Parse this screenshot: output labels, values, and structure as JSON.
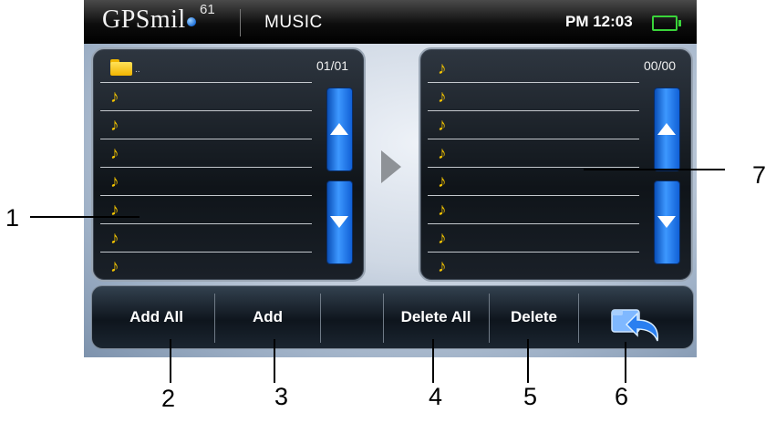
{
  "status_bar": {
    "brand": "GPSmil",
    "brand_suffix": "e",
    "brand_superscript": "61",
    "title": "MUSIC",
    "time": "PM 12:03",
    "battery_icon": "battery-icon",
    "battery_color": "#3ad43a"
  },
  "left_list": {
    "counter": "01/01",
    "folder_label": "..",
    "rows": [
      "♪",
      "♪",
      "♪",
      "♪",
      "♪",
      "♪",
      "♪"
    ]
  },
  "right_list": {
    "counter": "00/00",
    "rows": [
      "♪",
      "♪",
      "♪",
      "♪",
      "♪",
      "♪",
      "♪",
      "♪"
    ]
  },
  "toolbar": {
    "add_all": "Add All",
    "add": "Add",
    "empty": "",
    "delete_all": "Delete All",
    "delete": "Delete",
    "back_icon": "back-icon"
  },
  "callouts": {
    "c1": "1",
    "c2": "2",
    "c3": "3",
    "c4": "4",
    "c5": "5",
    "c6": "6",
    "c7": "7"
  },
  "colors": {
    "accent_blue": "#1e7ef0",
    "note_yellow": "#f2c300"
  }
}
